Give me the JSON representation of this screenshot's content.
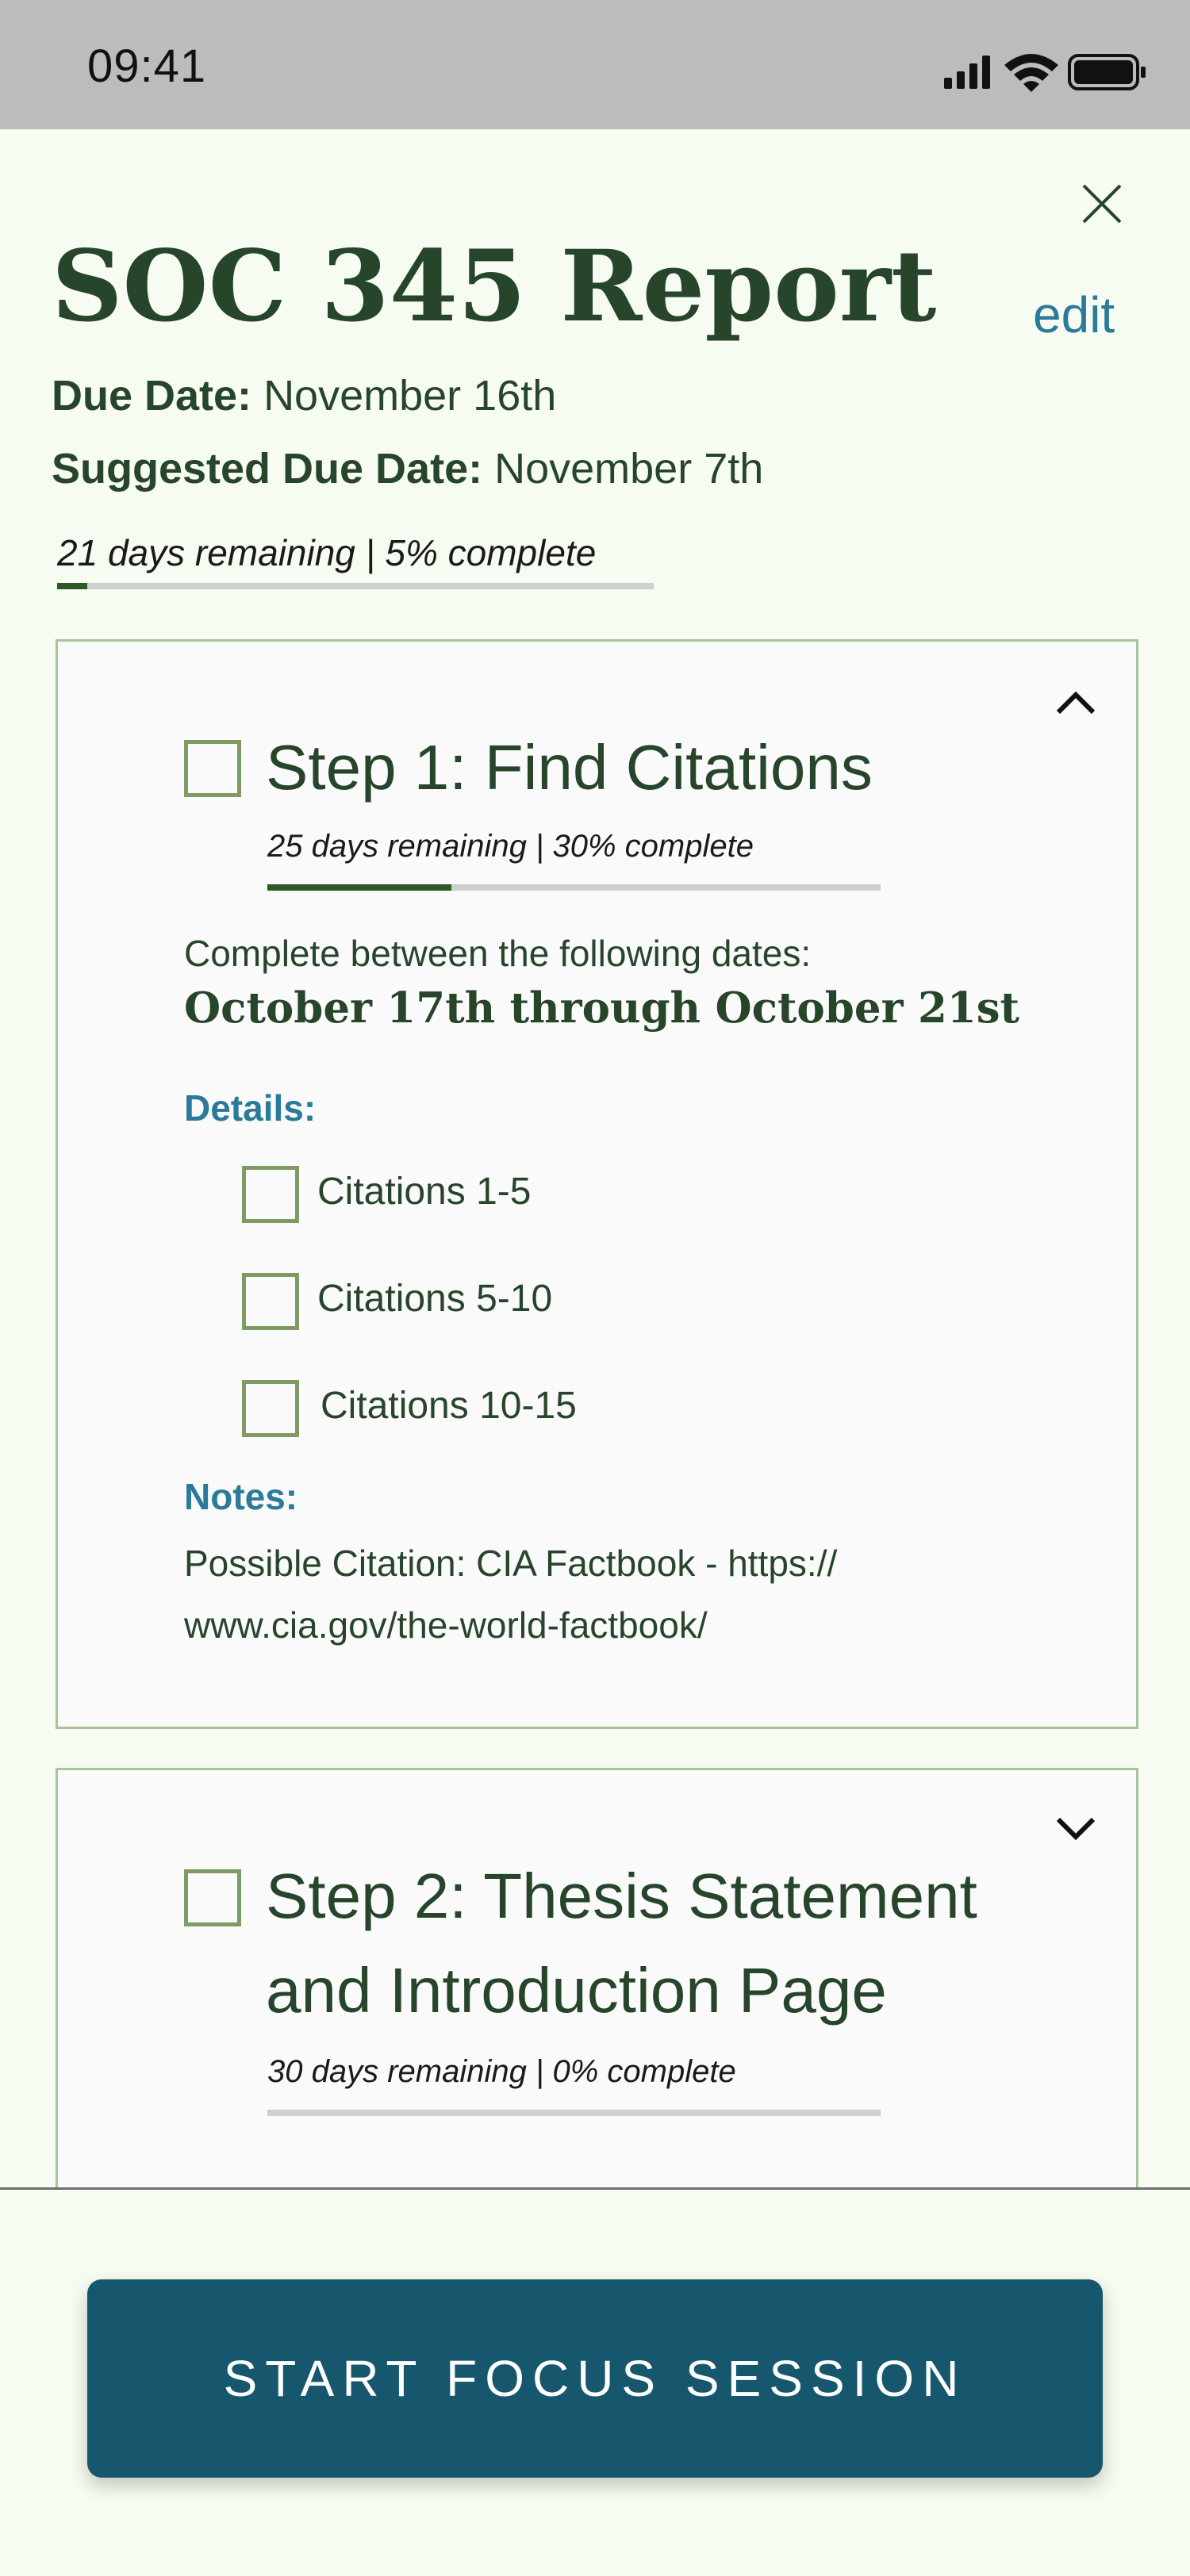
{
  "status_bar": {
    "time": "09:41"
  },
  "header": {
    "title": "SOC 345 Report",
    "edit_label": "edit",
    "due_date_label": "Due Date:",
    "due_date_value": "November 16th",
    "suggested_label": "Suggested Due Date:",
    "suggested_value": "November 7th",
    "progress_text": "21 days remaining | 5% complete",
    "progress_fraction": 0.05
  },
  "steps": [
    {
      "title": "Step 1: Find Citations",
      "progress_text": "25 days remaining | 30% complete",
      "progress_fraction": 0.3,
      "dates_label": "Complete between the following dates:",
      "dates_range": "October 17th through October 21st",
      "details_label": "Details:",
      "details": [
        "Citations 1-5",
        "Citations 5-10",
        "Citations 10-15"
      ],
      "notes_label": "Notes:",
      "notes_line1": "Possible Citation: CIA Factbook - https://",
      "notes_line2": "www.cia.gov/the-world-factbook/"
    },
    {
      "title_line1": "Step 2: Thesis Statement",
      "title_line2": "and Introduction Page",
      "progress_text": "30 days remaining | 0% complete",
      "progress_fraction": 0.0
    }
  ],
  "footer": {
    "button_label": "START FOCUS SESSION"
  },
  "colors": {
    "primary_green": "#27452a",
    "accent_blue": "#2b7a9a",
    "progress_fill": "#2c5a22",
    "button_bg": "#16576e",
    "card_border": "#a8c49a"
  }
}
